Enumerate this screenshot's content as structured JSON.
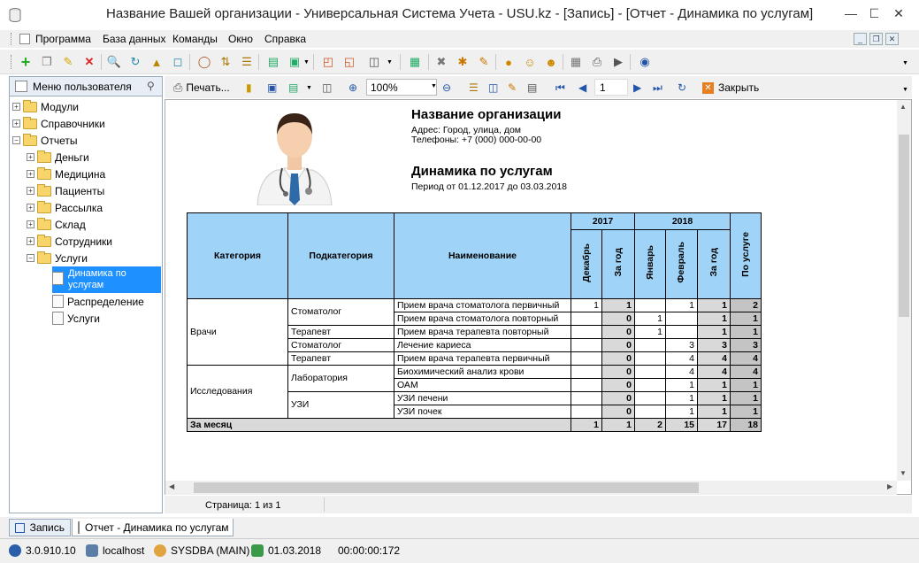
{
  "window": {
    "title": "Название Вашей организации - Универсальная Система Учета - USU.kz - [Запись] - [Отчет - Динамика по услугам]"
  },
  "menu": [
    "Программа",
    "База данных",
    "Команды",
    "Окно",
    "Справка"
  ],
  "left_panel": {
    "title": "Меню пользователя",
    "tree": [
      {
        "label": "Модули",
        "level": 0,
        "toggle": "+"
      },
      {
        "label": "Справочники",
        "level": 0,
        "toggle": "+"
      },
      {
        "label": "Отчеты",
        "level": 0,
        "toggle": "−"
      },
      {
        "label": "Деньги",
        "level": 1,
        "toggle": "+"
      },
      {
        "label": "Медицина",
        "level": 1,
        "toggle": "+"
      },
      {
        "label": "Пациенты",
        "level": 1,
        "toggle": "+"
      },
      {
        "label": "Рассылка",
        "level": 1,
        "toggle": "+"
      },
      {
        "label": "Склад",
        "level": 1,
        "toggle": "+"
      },
      {
        "label": "Сотрудники",
        "level": 1,
        "toggle": "+"
      },
      {
        "label": "Услуги",
        "level": 1,
        "toggle": "−"
      }
    ],
    "leaves": [
      "Динамика по услугам",
      "Распределение",
      "Услуги"
    ]
  },
  "report_toolbar": {
    "print": "Печать...",
    "zoom": "100%",
    "page_input": "1",
    "close": "Закрыть"
  },
  "report": {
    "org_name": "Название организации",
    "address": "Адрес: Город, улица, дом",
    "phones": "Телефоны: +7 (000) 000-00-00",
    "title": "Динамика по услугам",
    "period": "Период от 01.12.2017 до 03.03.2018",
    "headers": {
      "category": "Категория",
      "subcategory": "Подкатегория",
      "name": "Наименование",
      "y2017": "2017",
      "y2018": "2018",
      "dec": "Декабрь",
      "per_year": "За год",
      "jan": "Январь",
      "feb": "Февраль",
      "per_service": "По услуге"
    },
    "rows": [
      {
        "cat": "Врачи",
        "sub": "Стоматолог",
        "name": "Прием врача стоматолога первичный",
        "dec": "1",
        "y17": "1",
        "jan": "",
        "feb": "1",
        "y18": "1",
        "tot": "2"
      },
      {
        "cat": "",
        "sub": "",
        "name": "Прием врача стоматолога повторный",
        "dec": "",
        "y17": "0",
        "jan": "1",
        "feb": "",
        "y18": "1",
        "tot": "1"
      },
      {
        "cat": "",
        "sub": "Терапевт",
        "name": "Прием врача терапевта повторный",
        "dec": "",
        "y17": "0",
        "jan": "1",
        "feb": "",
        "y18": "1",
        "tot": "1"
      },
      {
        "cat": "",
        "sub": "Стоматолог",
        "name": "Лечение кариеса",
        "dec": "",
        "y17": "0",
        "jan": "",
        "feb": "3",
        "y18": "3",
        "tot": "3"
      },
      {
        "cat": "",
        "sub": "Терапевт",
        "name": "Прием врача терапевта первичный",
        "dec": "",
        "y17": "0",
        "jan": "",
        "feb": "4",
        "y18": "4",
        "tot": "4"
      },
      {
        "cat": "Исследования",
        "sub": "Лаборатория",
        "name": "Биохимический анализ крови",
        "dec": "",
        "y17": "0",
        "jan": "",
        "feb": "4",
        "y18": "4",
        "tot": "4"
      },
      {
        "cat": "",
        "sub": "",
        "name": "ОАМ",
        "dec": "",
        "y17": "0",
        "jan": "",
        "feb": "1",
        "y18": "1",
        "tot": "1"
      },
      {
        "cat": "",
        "sub": "УЗИ",
        "name": "УЗИ печени",
        "dec": "",
        "y17": "0",
        "jan": "",
        "feb": "1",
        "y18": "1",
        "tot": "1"
      },
      {
        "cat": "",
        "sub": "",
        "name": "УЗИ почек",
        "dec": "",
        "y17": "0",
        "jan": "",
        "feb": "1",
        "y18": "1",
        "tot": "1"
      }
    ],
    "total": {
      "label": "За месяц",
      "dec": "1",
      "y17": "1",
      "jan": "2",
      "feb": "15",
      "y18": "17",
      "tot": "18"
    }
  },
  "page_status": "Страница: 1 из 1",
  "tabs": [
    "Запись",
    "Отчет - Динамика по услугам"
  ],
  "statusbar": {
    "version": "3.0.910.10",
    "server": "localhost",
    "user": "SYSDBA (MAIN)",
    "date": "01.03.2018",
    "timer": "00:00:00:172"
  }
}
